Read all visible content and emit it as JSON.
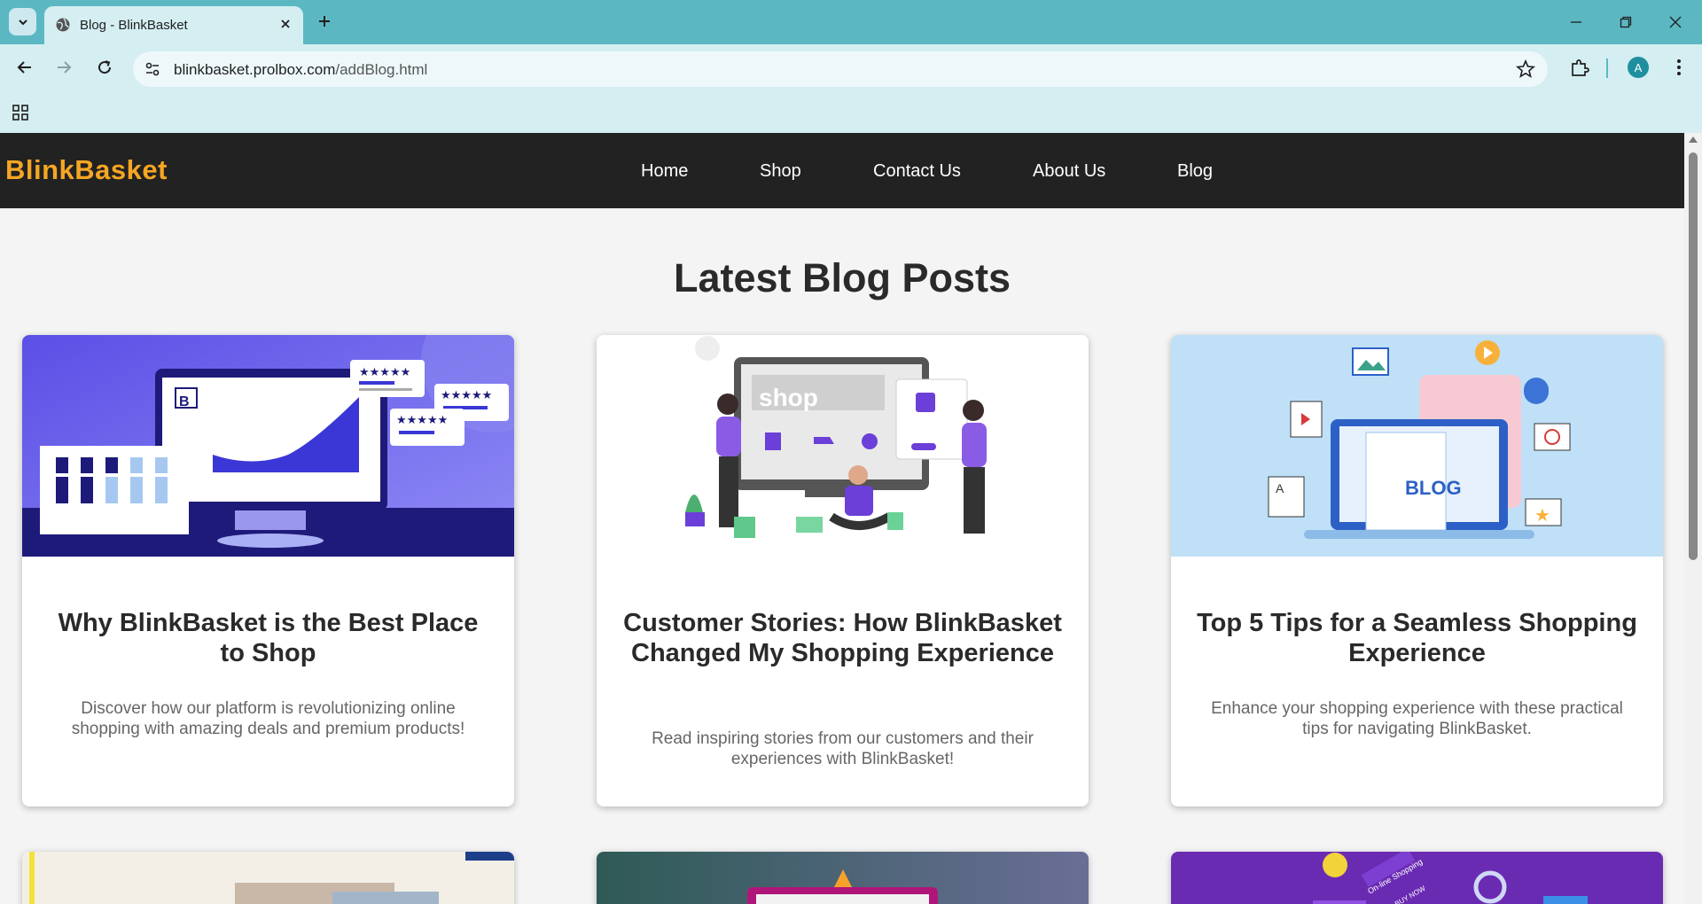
{
  "browser": {
    "tab_title": "Blog - BlinkBasket",
    "url_host": "blinkbasket.prolbox.com",
    "url_path": "/addBlog.html",
    "profile_initial": "A"
  },
  "site": {
    "brand": "BlinkBasket",
    "nav": [
      "Home",
      "Shop",
      "Contact Us",
      "About Us",
      "Blog"
    ],
    "page_title": "Latest Blog Posts",
    "posts": [
      {
        "title": "Why BlinkBasket is the Best Place to Shop",
        "excerpt": "Discover how our platform is revolutionizing online shopping with amazing deals and premium products!",
        "image_text": ""
      },
      {
        "title": "Customer Stories: How BlinkBasket Changed My Shopping Experience",
        "excerpt": "Read inspiring stories from our customers and their experiences with BlinkBasket!",
        "image_text": "shop"
      },
      {
        "title": "Top 5 Tips for a Seamless Shopping Experience",
        "excerpt": "Enhance your shopping experience with these practical tips for navigating BlinkBasket.",
        "image_text": "BLOG"
      }
    ],
    "second_row_image_texts": [
      "",
      "",
      "On-line Shopping",
      "BUY NOW"
    ]
  },
  "colors": {
    "brand": "#f5a623",
    "nav_bg": "#222222",
    "page_bg": "#f4f4f4",
    "chrome_tab": "#5bb8c3",
    "chrome_toolbar": "#d4eef2"
  }
}
